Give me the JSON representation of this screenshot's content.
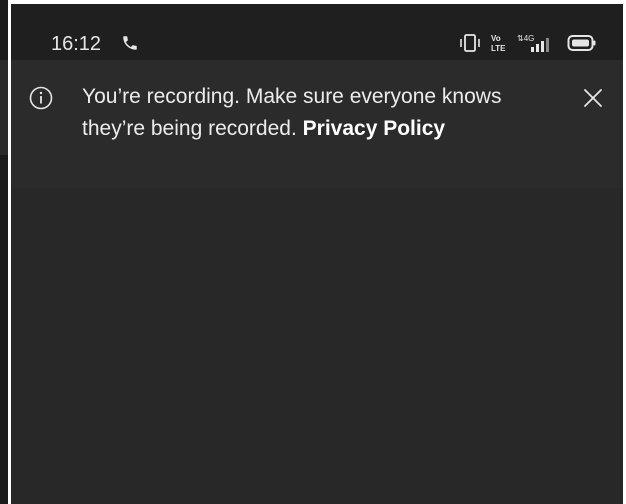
{
  "status_bar": {
    "time": "16:12",
    "icons": [
      "call-icon",
      "vibrate-icon",
      "volte-icon",
      "4g-signal-icon",
      "battery-icon"
    ]
  },
  "banner": {
    "message": "You’re recording. Make sure everyone knows they’re being recorded.",
    "link_label": "Privacy Policy",
    "icon": "info-icon",
    "close_icon": "close-icon"
  },
  "colors": {
    "background": "#282828",
    "banner": "#2b2b2b",
    "status_bar": "#1f1f1f",
    "text": "#ececec"
  }
}
